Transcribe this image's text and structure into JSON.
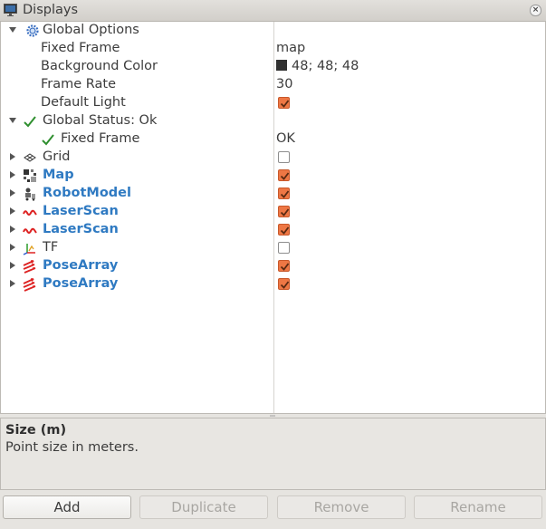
{
  "window": {
    "title": "Displays"
  },
  "tree": {
    "global_options": {
      "label": "Global Options",
      "fixed_frame": {
        "label": "Fixed Frame",
        "value": "map"
      },
      "background_color": {
        "label": "Background Color",
        "value": "48; 48; 48",
        "swatch": "#303030"
      },
      "frame_rate": {
        "label": "Frame Rate",
        "value": "30"
      },
      "default_light": {
        "label": "Default Light",
        "checked": true
      }
    },
    "global_status": {
      "label": "Global Status: Ok",
      "fixed_frame": {
        "label": "Fixed Frame",
        "value": "OK"
      }
    },
    "displays": [
      {
        "label": "Grid",
        "icon": "grid-icon",
        "checked": false
      },
      {
        "label": "Map",
        "icon": "map-icon",
        "checked": true
      },
      {
        "label": "RobotModel",
        "icon": "robot-model-icon",
        "checked": true
      },
      {
        "label": "LaserScan",
        "icon": "laser-scan-icon",
        "checked": true
      },
      {
        "label": "LaserScan",
        "icon": "laser-scan-icon",
        "checked": true
      },
      {
        "label": "TF",
        "icon": "tf-axes-icon",
        "checked": false
      },
      {
        "label": "PoseArray",
        "icon": "pose-array-icon",
        "checked": true
      },
      {
        "label": "PoseArray",
        "icon": "pose-array-icon",
        "checked": true
      }
    ]
  },
  "description": {
    "title": "Size (m)",
    "text": "Point size in meters."
  },
  "buttons": {
    "add": "Add",
    "duplicate": "Duplicate",
    "remove": "Remove",
    "rename": "Rename"
  },
  "colors": {
    "checkbox_on": "#ee7744",
    "display_label": "#2f7ac2"
  }
}
